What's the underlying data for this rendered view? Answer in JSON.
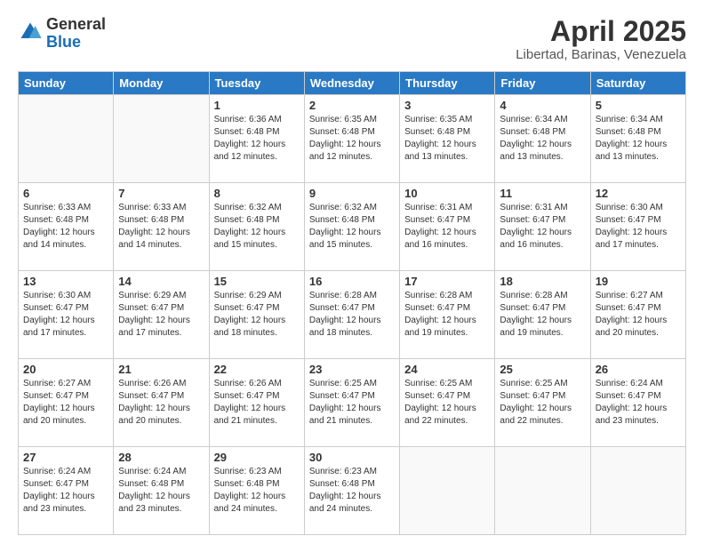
{
  "logo": {
    "general": "General",
    "blue": "Blue"
  },
  "header": {
    "title": "April 2025",
    "location": "Libertad, Barinas, Venezuela"
  },
  "weekdays": [
    "Sunday",
    "Monday",
    "Tuesday",
    "Wednesday",
    "Thursday",
    "Friday",
    "Saturday"
  ],
  "weeks": [
    [
      {
        "day": "",
        "info": ""
      },
      {
        "day": "",
        "info": ""
      },
      {
        "day": "1",
        "info": "Sunrise: 6:36 AM\nSunset: 6:48 PM\nDaylight: 12 hours and 12 minutes."
      },
      {
        "day": "2",
        "info": "Sunrise: 6:35 AM\nSunset: 6:48 PM\nDaylight: 12 hours and 12 minutes."
      },
      {
        "day": "3",
        "info": "Sunrise: 6:35 AM\nSunset: 6:48 PM\nDaylight: 12 hours and 13 minutes."
      },
      {
        "day": "4",
        "info": "Sunrise: 6:34 AM\nSunset: 6:48 PM\nDaylight: 12 hours and 13 minutes."
      },
      {
        "day": "5",
        "info": "Sunrise: 6:34 AM\nSunset: 6:48 PM\nDaylight: 12 hours and 13 minutes."
      }
    ],
    [
      {
        "day": "6",
        "info": "Sunrise: 6:33 AM\nSunset: 6:48 PM\nDaylight: 12 hours and 14 minutes."
      },
      {
        "day": "7",
        "info": "Sunrise: 6:33 AM\nSunset: 6:48 PM\nDaylight: 12 hours and 14 minutes."
      },
      {
        "day": "8",
        "info": "Sunrise: 6:32 AM\nSunset: 6:48 PM\nDaylight: 12 hours and 15 minutes."
      },
      {
        "day": "9",
        "info": "Sunrise: 6:32 AM\nSunset: 6:48 PM\nDaylight: 12 hours and 15 minutes."
      },
      {
        "day": "10",
        "info": "Sunrise: 6:31 AM\nSunset: 6:47 PM\nDaylight: 12 hours and 16 minutes."
      },
      {
        "day": "11",
        "info": "Sunrise: 6:31 AM\nSunset: 6:47 PM\nDaylight: 12 hours and 16 minutes."
      },
      {
        "day": "12",
        "info": "Sunrise: 6:30 AM\nSunset: 6:47 PM\nDaylight: 12 hours and 17 minutes."
      }
    ],
    [
      {
        "day": "13",
        "info": "Sunrise: 6:30 AM\nSunset: 6:47 PM\nDaylight: 12 hours and 17 minutes."
      },
      {
        "day": "14",
        "info": "Sunrise: 6:29 AM\nSunset: 6:47 PM\nDaylight: 12 hours and 17 minutes."
      },
      {
        "day": "15",
        "info": "Sunrise: 6:29 AM\nSunset: 6:47 PM\nDaylight: 12 hours and 18 minutes."
      },
      {
        "day": "16",
        "info": "Sunrise: 6:28 AM\nSunset: 6:47 PM\nDaylight: 12 hours and 18 minutes."
      },
      {
        "day": "17",
        "info": "Sunrise: 6:28 AM\nSunset: 6:47 PM\nDaylight: 12 hours and 19 minutes."
      },
      {
        "day": "18",
        "info": "Sunrise: 6:28 AM\nSunset: 6:47 PM\nDaylight: 12 hours and 19 minutes."
      },
      {
        "day": "19",
        "info": "Sunrise: 6:27 AM\nSunset: 6:47 PM\nDaylight: 12 hours and 20 minutes."
      }
    ],
    [
      {
        "day": "20",
        "info": "Sunrise: 6:27 AM\nSunset: 6:47 PM\nDaylight: 12 hours and 20 minutes."
      },
      {
        "day": "21",
        "info": "Sunrise: 6:26 AM\nSunset: 6:47 PM\nDaylight: 12 hours and 20 minutes."
      },
      {
        "day": "22",
        "info": "Sunrise: 6:26 AM\nSunset: 6:47 PM\nDaylight: 12 hours and 21 minutes."
      },
      {
        "day": "23",
        "info": "Sunrise: 6:25 AM\nSunset: 6:47 PM\nDaylight: 12 hours and 21 minutes."
      },
      {
        "day": "24",
        "info": "Sunrise: 6:25 AM\nSunset: 6:47 PM\nDaylight: 12 hours and 22 minutes."
      },
      {
        "day": "25",
        "info": "Sunrise: 6:25 AM\nSunset: 6:47 PM\nDaylight: 12 hours and 22 minutes."
      },
      {
        "day": "26",
        "info": "Sunrise: 6:24 AM\nSunset: 6:47 PM\nDaylight: 12 hours and 23 minutes."
      }
    ],
    [
      {
        "day": "27",
        "info": "Sunrise: 6:24 AM\nSunset: 6:47 PM\nDaylight: 12 hours and 23 minutes."
      },
      {
        "day": "28",
        "info": "Sunrise: 6:24 AM\nSunset: 6:48 PM\nDaylight: 12 hours and 23 minutes."
      },
      {
        "day": "29",
        "info": "Sunrise: 6:23 AM\nSunset: 6:48 PM\nDaylight: 12 hours and 24 minutes."
      },
      {
        "day": "30",
        "info": "Sunrise: 6:23 AM\nSunset: 6:48 PM\nDaylight: 12 hours and 24 minutes."
      },
      {
        "day": "",
        "info": ""
      },
      {
        "day": "",
        "info": ""
      },
      {
        "day": "",
        "info": ""
      }
    ]
  ]
}
